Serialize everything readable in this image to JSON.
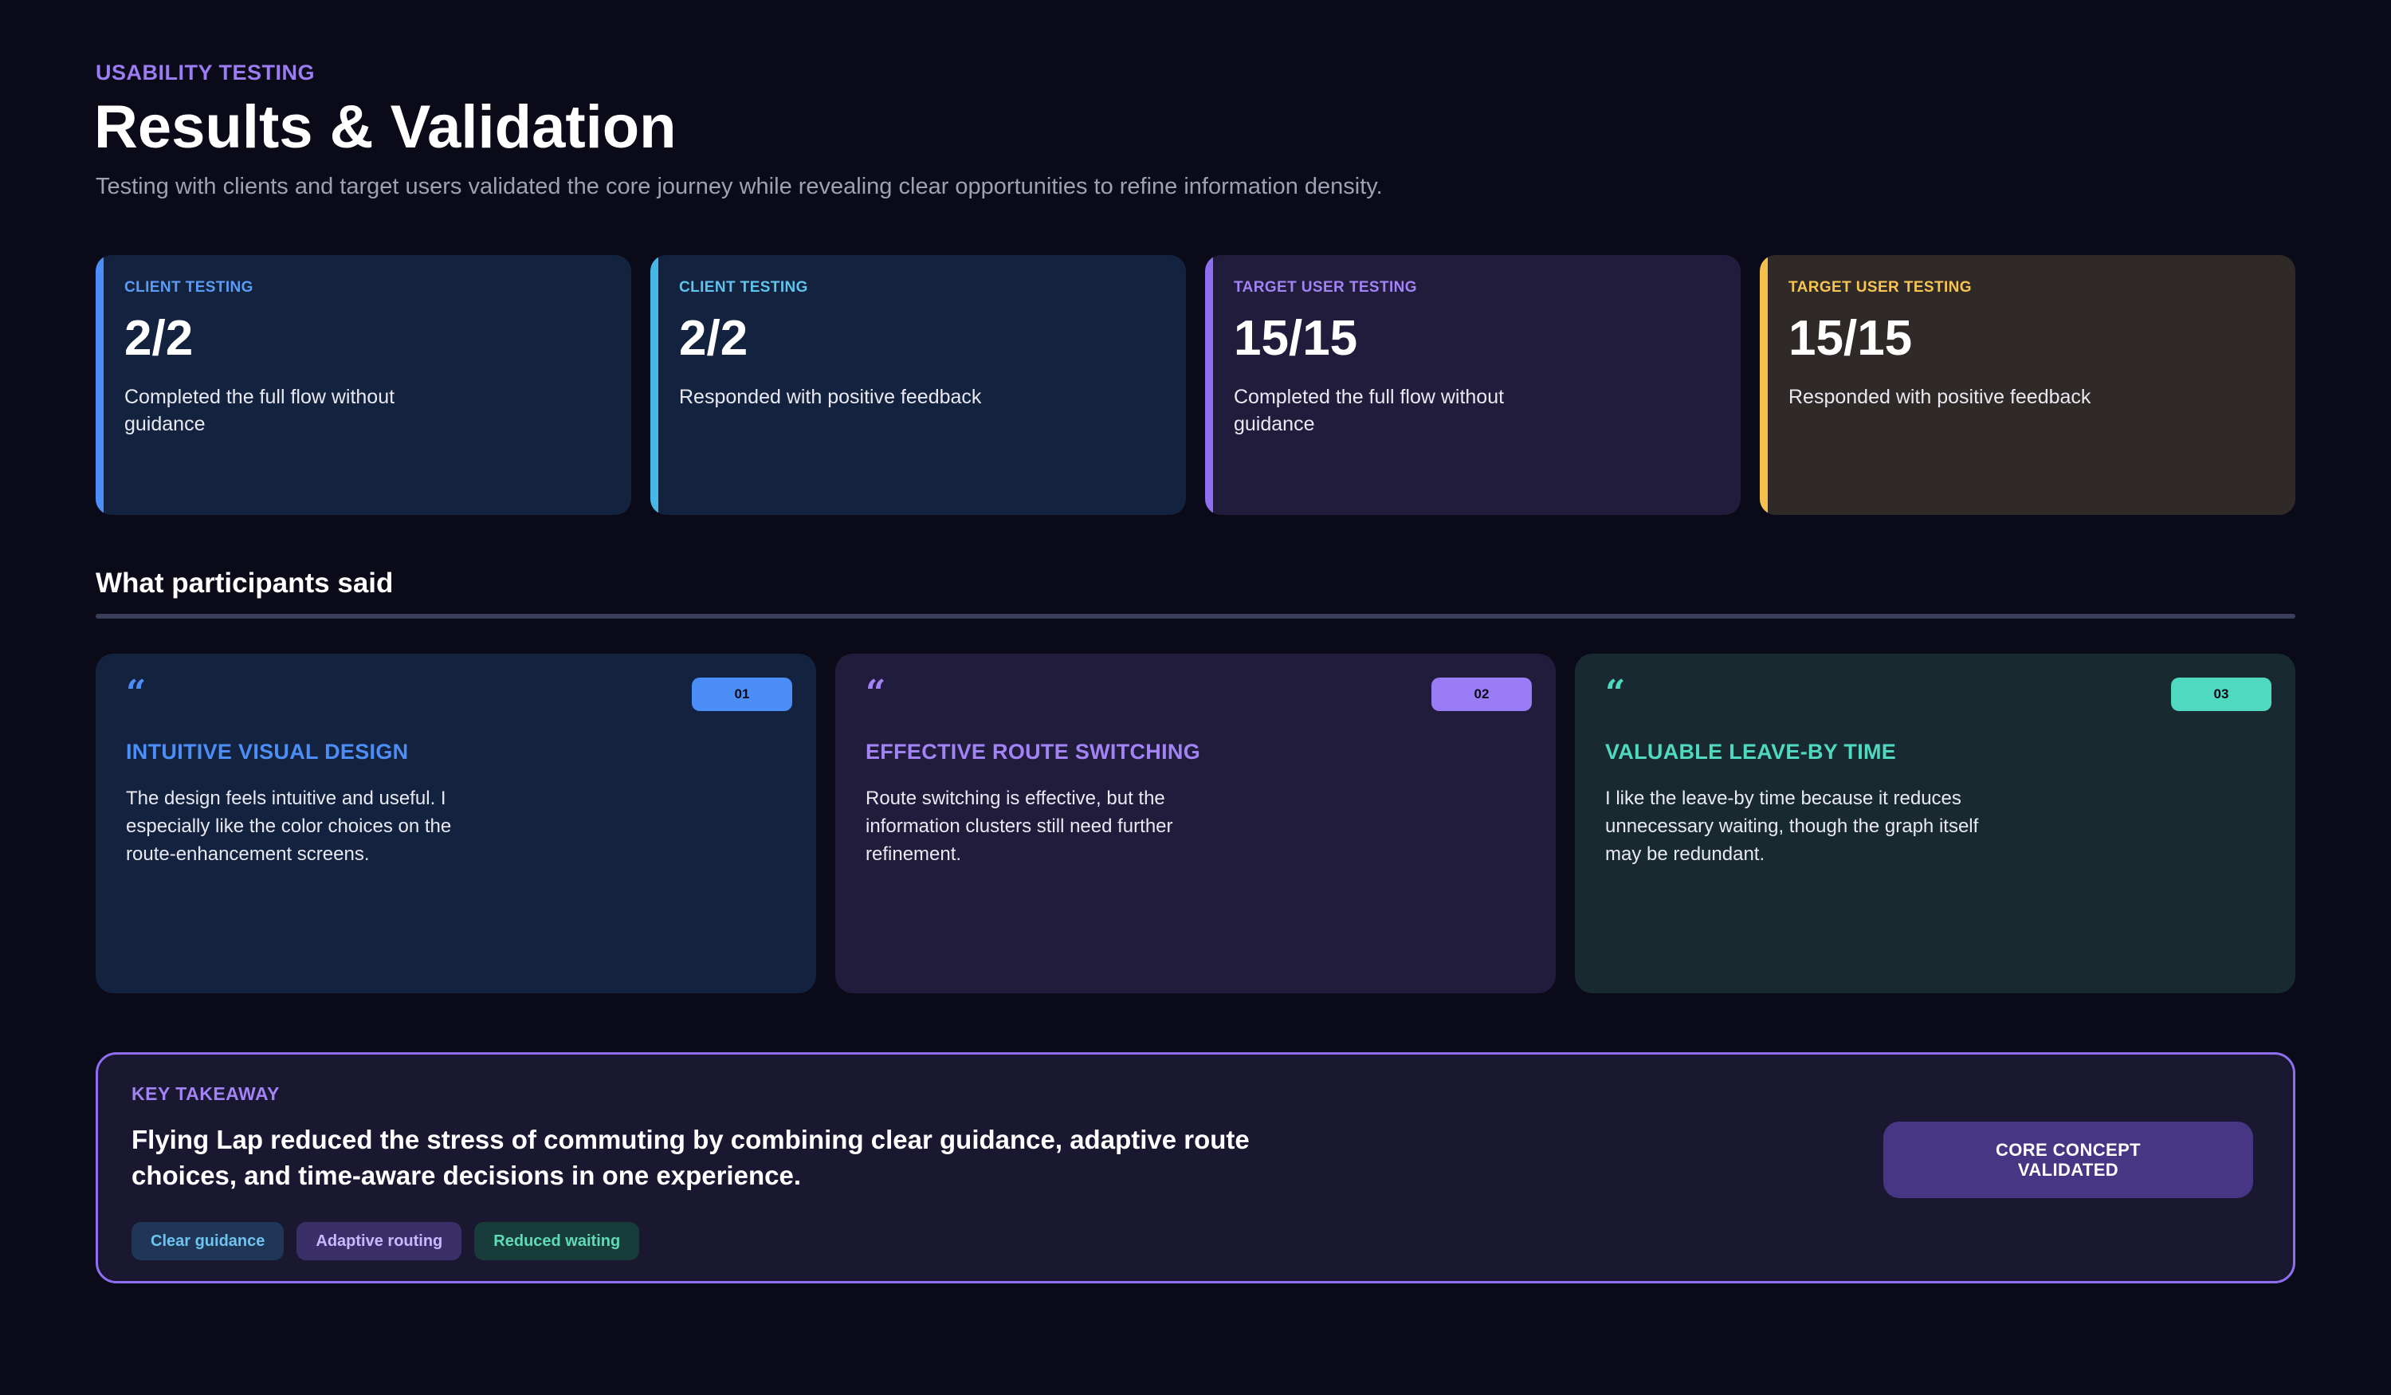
{
  "header": {
    "eyebrow": "USABILITY TESTING",
    "title": "Results & Validation",
    "subtitle": "Testing with clients and target users validated the core journey while revealing clear opportunities to refine information density."
  },
  "stats": [
    {
      "label": "CLIENT TESTING",
      "value": "2/2",
      "desc": "Completed the full flow without guidance",
      "accent": "#4c8ef7"
    },
    {
      "label": "CLIENT TESTING",
      "value": "2/2",
      "desc": "Responded with positive feedback",
      "accent": "#46b8e6"
    },
    {
      "label": "TARGET USER TESTING",
      "value": "15/15",
      "desc": "Completed the full flow without guidance",
      "accent": "#8f6ef0"
    },
    {
      "label": "TARGET USER TESTING",
      "value": "15/15",
      "desc": "Responded with positive feedback",
      "accent": "#f5c14c"
    }
  ],
  "participants": {
    "title": "What participants said",
    "quotes": [
      {
        "mark": "“",
        "badge": "01",
        "heading": "INTUITIVE VISUAL DESIGN",
        "text": "The design feels intuitive and useful. I especially like the color choices on the route-enhancement screens.",
        "accent": "#4c8ef7"
      },
      {
        "mark": "“",
        "badge": "02",
        "heading": "EFFECTIVE ROUTE SWITCHING",
        "text": "Route switching is effective, but the information clusters still need further refinement.",
        "accent": "#a183f5"
      },
      {
        "mark": "“",
        "badge": "03",
        "heading": "VALUABLE LEAVE-BY TIME",
        "text": "I like the leave-by time because it reduces unnecessary waiting, though the graph itself may be redundant.",
        "accent": "#4fd9c0"
      }
    ]
  },
  "takeaway": {
    "label": "KEY TAKEAWAY",
    "text": "Flying Lap reduced the stress of commuting by combining clear guidance, adaptive route choices, and time-aware decisions in one experience.",
    "chips": [
      "Clear guidance",
      "Adaptive routing",
      "Reduced waiting"
    ],
    "button_label": "CORE CONCEPT\nVALIDATED"
  }
}
